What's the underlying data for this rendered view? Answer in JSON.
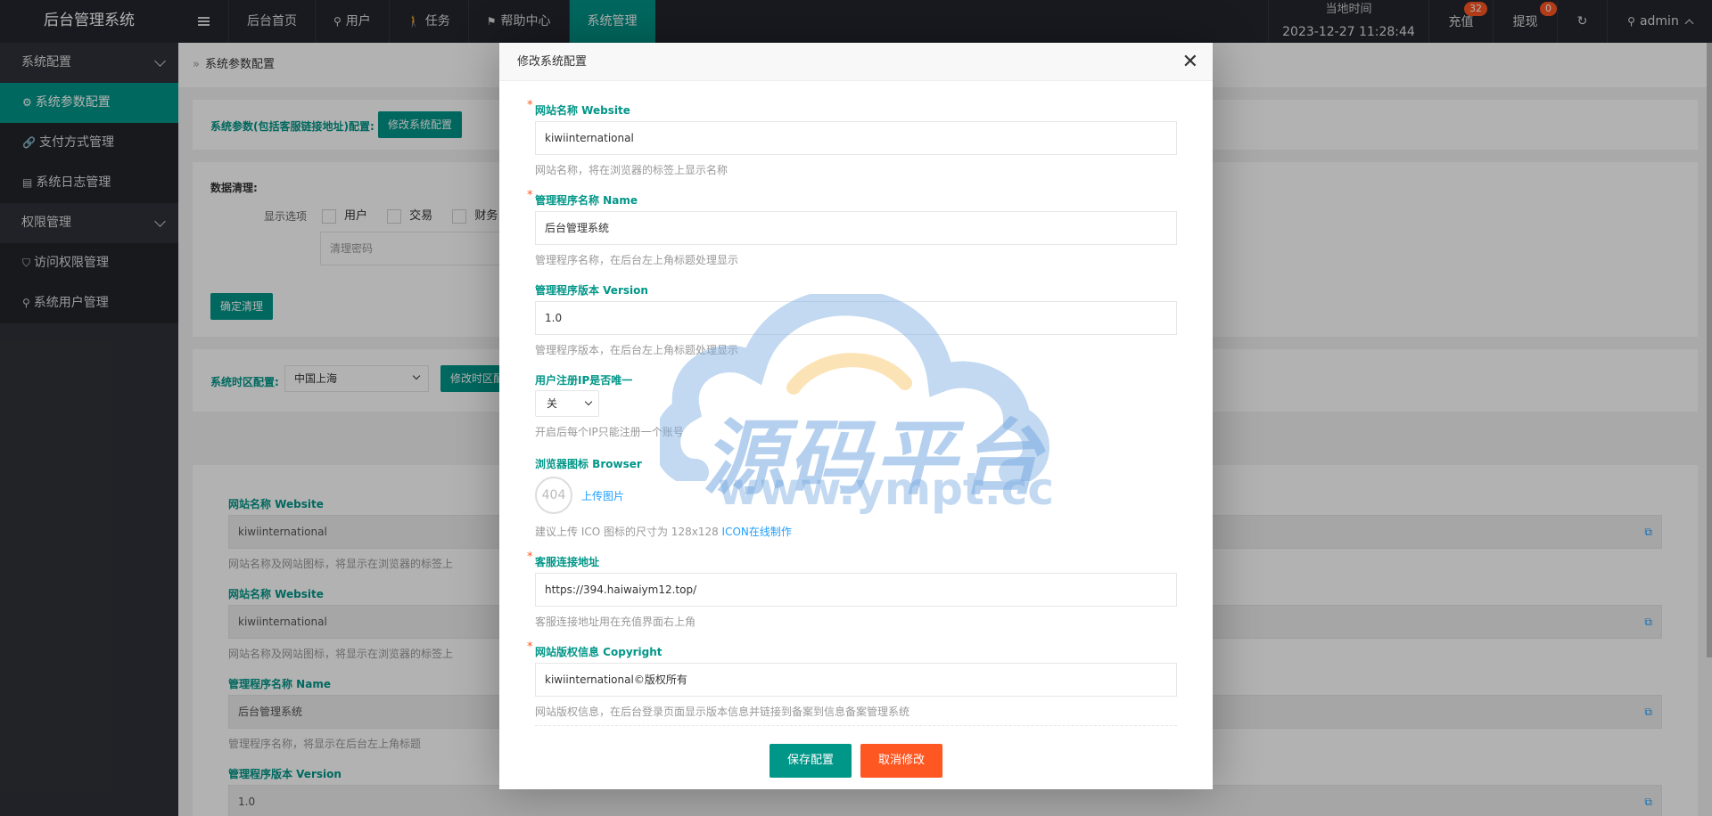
{
  "header": {
    "logo": "后台管理系统",
    "nav": [
      {
        "label": "后台首页",
        "icon": "",
        "active": false
      },
      {
        "label": "用户",
        "icon": "user-icon",
        "active": false
      },
      {
        "label": "任务",
        "icon": "walk-icon",
        "active": false
      },
      {
        "label": "帮助中心",
        "icon": "flag-icon",
        "active": false
      },
      {
        "label": "系统管理",
        "icon": "",
        "active": true
      }
    ],
    "time_label": "当地时间",
    "time_value": "2023-12-27 11:28:44",
    "recharge_label": "充值",
    "recharge_badge": "32",
    "withdraw_label": "提现",
    "withdraw_badge": "0",
    "user_label": "admin"
  },
  "sidebar": {
    "groups": [
      {
        "label": "系统配置",
        "items": [
          "系统参数配置",
          "支付方式管理",
          "系统日志管理"
        ]
      },
      {
        "label": "权限管理",
        "items": [
          "访问权限管理",
          "系统用户管理"
        ]
      }
    ]
  },
  "page": {
    "breadcrumb": "系统参数配置",
    "card1_label": "系统参数(包括客服链接地址)配置:",
    "card1_button": "修改系统配置",
    "clean_title": "数据清理:",
    "display_options_label": "显示选项",
    "options": [
      "用户",
      "交易",
      "财务"
    ],
    "clean_password_placeholder": "清理密码",
    "clean_button": "确定清理",
    "timezone_label": "系统时区配置:",
    "timezone_value": "中国上海",
    "timezone_button": "修改时区配置",
    "fields": [
      {
        "label": "网站名称 Website",
        "value": "kiwiinternational",
        "help": "网站名称及网站图标，将显示在浏览器的标签上"
      },
      {
        "label": "网站名称 Website",
        "value": "kiwiinternational",
        "help": "网站名称及网站图标，将显示在浏览器的标签上"
      },
      {
        "label": "管理程序名称 Name",
        "value": "后台管理系统",
        "help": "管理程序名称，将显示在后台左上角标题"
      },
      {
        "label": "管理程序版本 Version",
        "value": "1.0",
        "help": ""
      }
    ]
  },
  "modal": {
    "title": "修改系统配置",
    "website_label": "网站名称 Website",
    "website_value": "kiwiinternational",
    "website_help": "网站名称，将在浏览器的标签上显示名称",
    "name_label": "管理程序名称 Name",
    "name_value": "后台管理系统",
    "name_help": "管理程序名称，在后台左上角标题处理显示",
    "version_label": "管理程序版本 Version",
    "version_value": "1.0",
    "version_help": "管理程序版本，在后台左上角标题处理显示",
    "ip_label": "用户注册IP是否唯一",
    "ip_value": "关",
    "ip_help": "开启后每个IP只能注册一个账号",
    "browser_label": "浏览器图标 Browser",
    "icon_placeholder": "404",
    "upload_link": "上传图片",
    "browser_help": "建议上传 ICO 图标的尺寸为 128x128",
    "icon_online_link": "ICON在线制作",
    "service_label": "客服连接地址",
    "service_value": "https://394.haiwaiym12.top/",
    "service_help": "客服连接地址用在充值界面右上角",
    "copyright_label": "网站版权信息 Copyright",
    "copyright_value": "kiwiinternational©版权所有",
    "copyright_help": "网站版权信息，在后台登录页面显示版本信息并链接到备案到信息备案管理系统",
    "save_button": "保存配置",
    "cancel_button": "取消修改"
  },
  "watermark": {
    "text_cn": "源码平台",
    "text_url": "www.ympt.cc"
  },
  "colors": {
    "accent": "#009688",
    "danger": "#ff5722",
    "header_bg": "#23262e",
    "sidebar_bg": "#2f3238",
    "link": "#1e9fff"
  }
}
